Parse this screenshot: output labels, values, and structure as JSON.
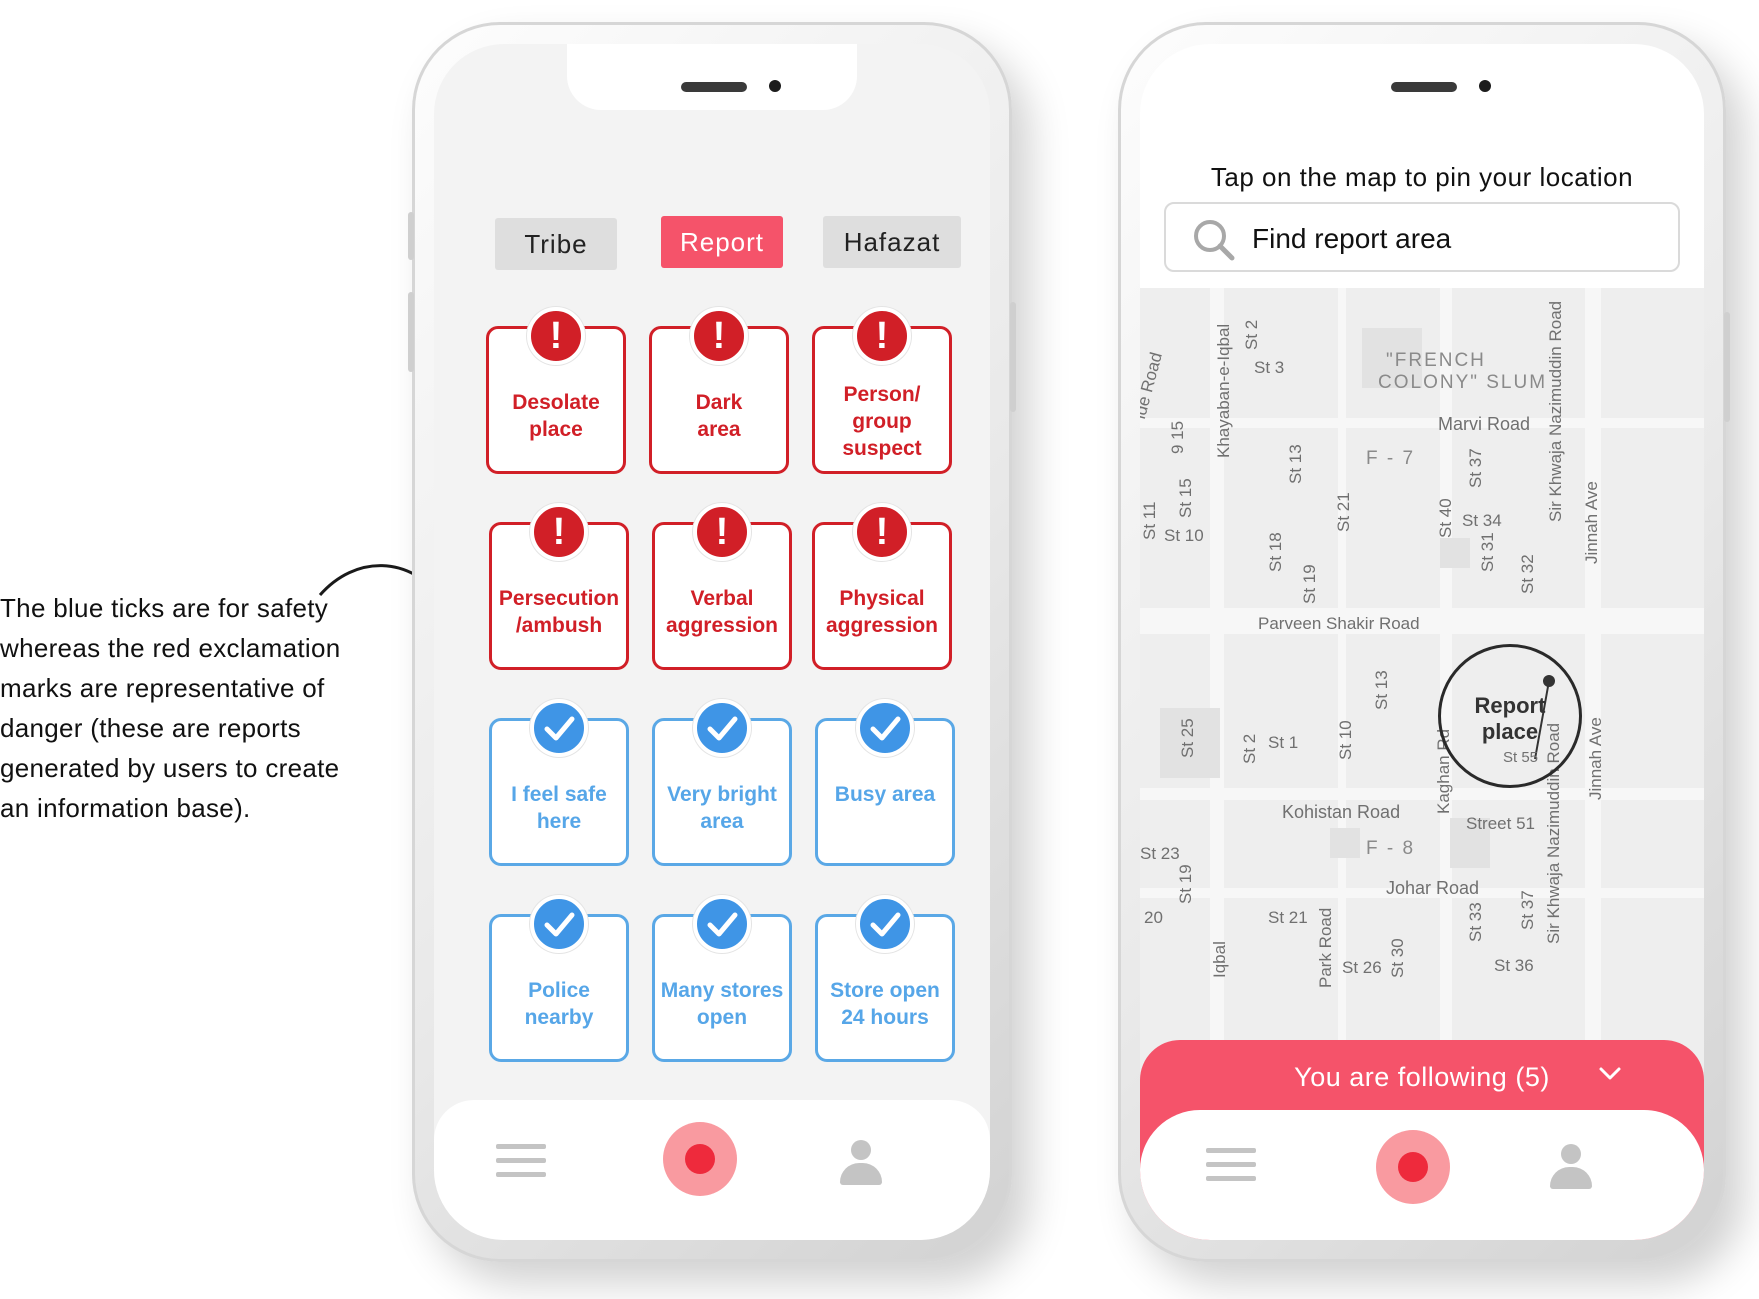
{
  "caption": "The blue ticks are for safety whereas the red exclamation marks are representative of danger (these are reports generated by users to create an information base).",
  "phone1": {
    "tabs": [
      {
        "label": "Tribe",
        "state": "inactive"
      },
      {
        "label": "Report",
        "state": "active"
      },
      {
        "label": "Hafazat",
        "state": "inactive"
      }
    ],
    "danger_cards": [
      {
        "label": "Desolate\nplace",
        "icon": "exclamation-icon"
      },
      {
        "label": "Dark\narea",
        "icon": "exclamation-icon"
      },
      {
        "label": "Person/\ngroup\nsuspect",
        "icon": "exclamation-icon"
      },
      {
        "label": "Persecution\n/ambush",
        "icon": "exclamation-icon"
      },
      {
        "label": "Verbal\naggression",
        "icon": "exclamation-icon"
      },
      {
        "label": "Physical\naggression",
        "icon": "exclamation-icon"
      }
    ],
    "safe_cards": [
      {
        "label": "I feel safe\nhere",
        "icon": "check-icon"
      },
      {
        "label": "Very bright\narea",
        "icon": "check-icon"
      },
      {
        "label": "Busy area",
        "icon": "check-icon"
      },
      {
        "label": "Police\nnearby",
        "icon": "check-icon"
      },
      {
        "label": "Many stores\nopen",
        "icon": "check-icon"
      },
      {
        "label": "Store open\n24 hours",
        "icon": "check-icon"
      }
    ],
    "nav": [
      "menu-icon",
      "record-icon",
      "user-icon"
    ]
  },
  "phone2": {
    "title": "Tap on the map to pin your location",
    "search": {
      "placeholder": "Find report area",
      "icon": "search-icon"
    },
    "map_labels": {
      "french_colony_1": "\"FRENCH",
      "french_colony_2": "COLONY\" SLUM",
      "marvi": "Marvi Road",
      "f7": "F - 7",
      "f8": "F - 8",
      "parveen": "Parveen Shakir Road",
      "kohistan": "Kohistan Road",
      "johar": "Johar Road",
      "street51": "Street 51",
      "st3": "St 3",
      "st10": "St 10",
      "st34": "St 34",
      "st1": "St 1",
      "st55": "St 55",
      "st23": "St 23",
      "st21": "St 21",
      "st36": "St 36",
      "st26": "St 26",
      "twenty": "20",
      "khayaban": "Khayaban-e-Iqbal",
      "khwaja": "Sir Khwaja Nazimuddin Road",
      "khwaja2": "Sir Khwaja Nazimuddin Road",
      "jinnah": "Jinnah Ave",
      "jinnah2": "Jinnah Ave",
      "kaghan": "Kaghan Rd",
      "st2a": "St 2",
      "st13": "St 13",
      "st15": "St 15",
      "st11": "St 11",
      "st18": "St 18",
      "st19": "St 19",
      "st21v": "St 21",
      "st40": "St 40",
      "st37": "St 37",
      "st31": "St 31",
      "st32": "St 32",
      "st25": "St 25",
      "st2b": "St 2",
      "st10v": "St 10",
      "st13b": "St 13",
      "st19b": "St 19",
      "st33": "St 33",
      "st37b": "St 37",
      "iqbal": "Iqbal",
      "park": "Park Road",
      "st30": "St 30",
      "road915": "9 15",
      "ide_road": "ide Road"
    },
    "report_pin": "Report\nplace",
    "following": "You are following (5)",
    "nav": [
      "menu-icon",
      "record-icon",
      "user-icon"
    ]
  },
  "colors": {
    "accent": "#f5536a",
    "danger": "#d11f27",
    "safe": "#3f95e6"
  }
}
